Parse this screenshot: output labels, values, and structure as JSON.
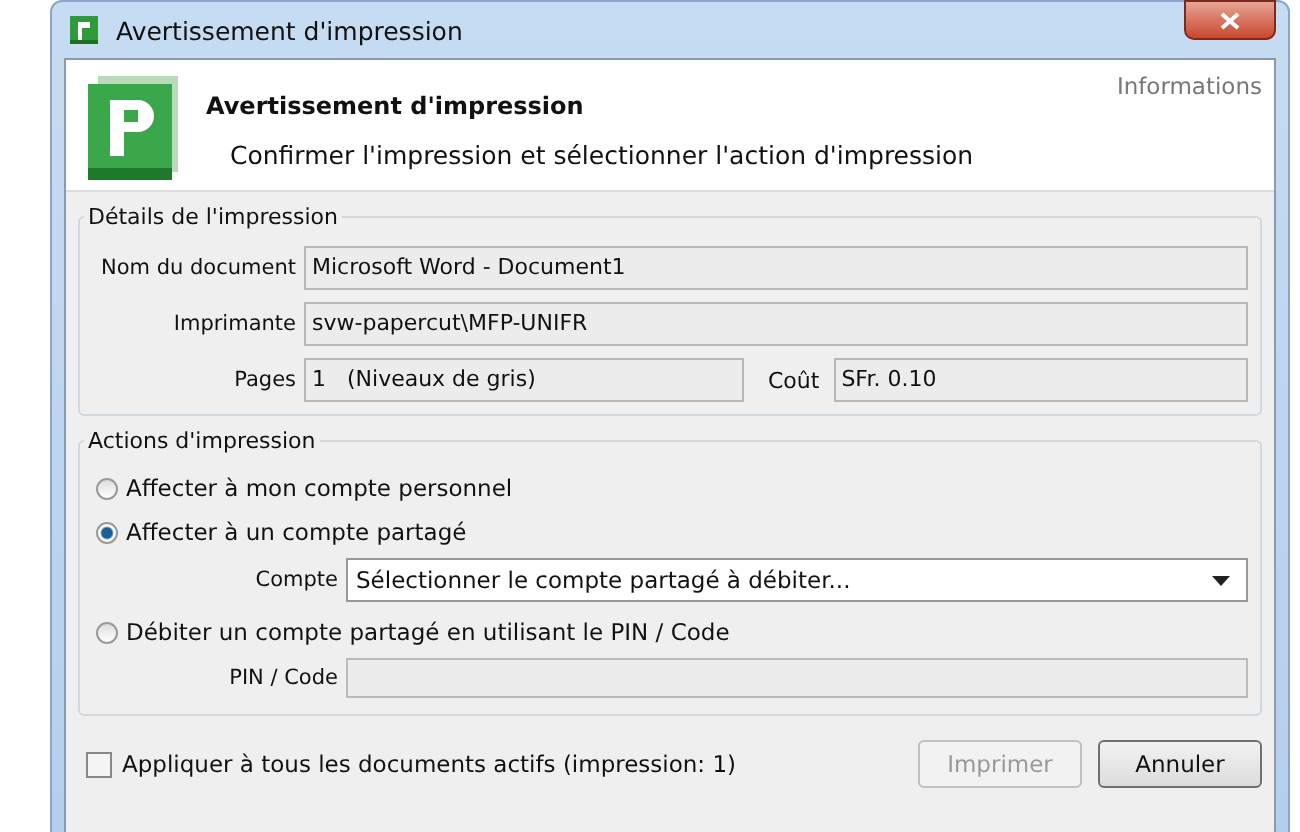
{
  "window": {
    "title": "Avertissement d'impression"
  },
  "header": {
    "title": "Avertissement d'impression",
    "subtitle": "Confirmer l'impression et sélectionner l'action d'impression",
    "info_link": "Informations"
  },
  "details": {
    "legend": "Détails de l'impression",
    "document": {
      "label": "Nom du document",
      "value": "Microsoft Word - Document1"
    },
    "printer": {
      "label": "Imprimante",
      "value": "svw-papercut\\MFP-UNIFR"
    },
    "pages": {
      "label": "Pages",
      "value": "1   (Niveaux de gris)"
    },
    "cost": {
      "label": "Coût",
      "value": "SFr. 0.10"
    }
  },
  "actions": {
    "legend": "Actions d'impression",
    "options": [
      {
        "label": "Affecter à mon compte personnel",
        "selected": false
      },
      {
        "label": "Affecter à un compte partagé",
        "selected": true
      },
      {
        "label": "Débiter un compte partagé en utilisant le PIN / Code",
        "selected": false
      }
    ],
    "account": {
      "label": "Compte",
      "value": "Sélectionner le compte partagé à débiter..."
    },
    "pin": {
      "label": "PIN / Code"
    }
  },
  "apply_all": {
    "label": "Appliquer à tous les documents actifs (impression: 1)",
    "checked": false
  },
  "buttons": [
    {
      "label": "Imprimer",
      "disabled": true
    },
    {
      "label": "Annuler",
      "disabled": false
    }
  ]
}
